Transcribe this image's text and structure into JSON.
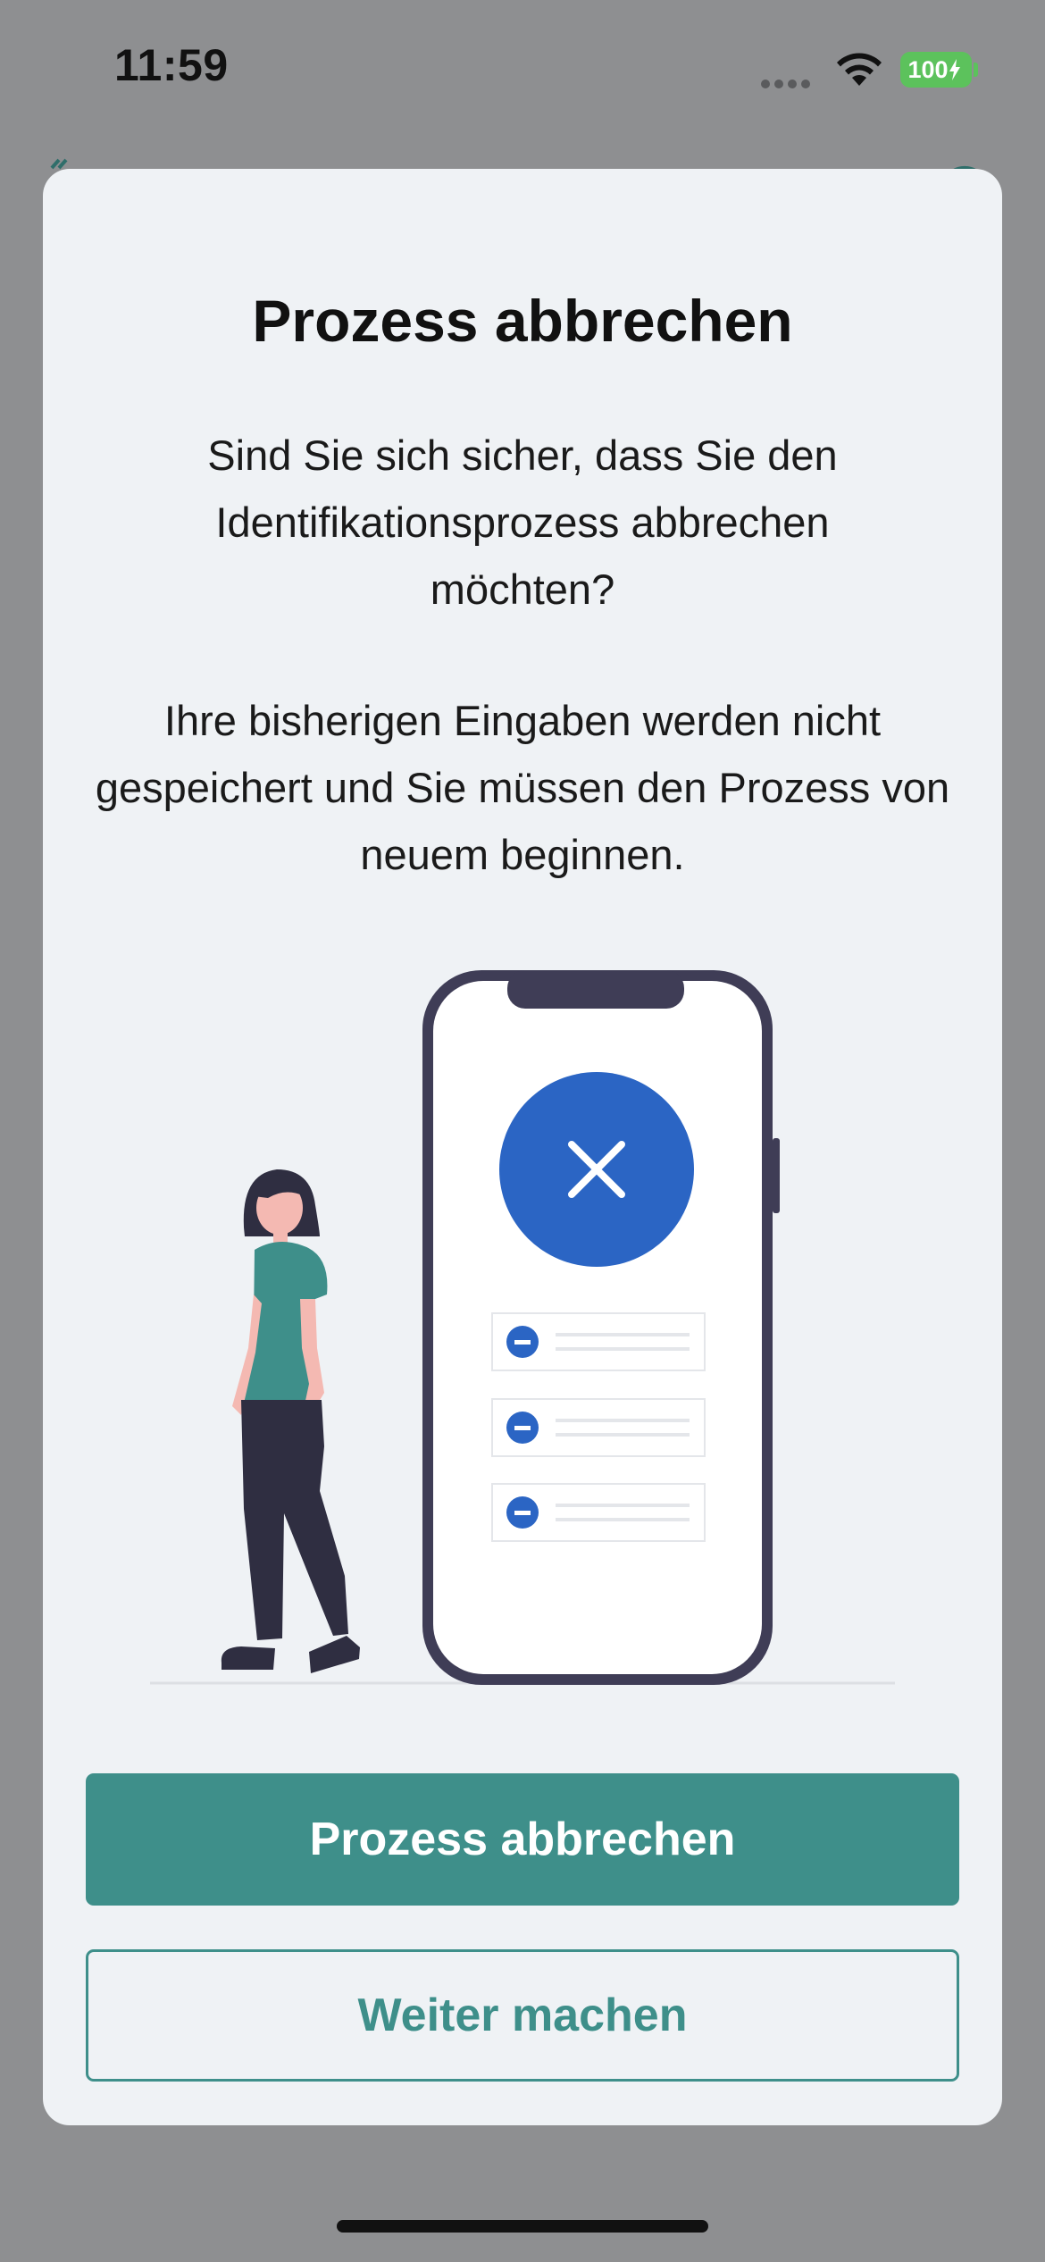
{
  "status_bar": {
    "time": "11:59",
    "battery_label": "100"
  },
  "dialog": {
    "title": "Prozess abbrechen",
    "message_1": "Sind Sie sich sicher, dass Sie den Identifikationsprozess abbrechen möchten?",
    "message_2": "Ihre bisherigen Eingaben werden nicht gespeichert und Sie müssen den Prozess von neuem beginnen.",
    "primary_button": "Prozess abbrechen",
    "secondary_button": "Weiter machen"
  },
  "colors": {
    "accent": "#3e8f8a",
    "illustration_blue": "#2b65c4",
    "phone_frame": "#3f3d56",
    "background_overlay": "#8e8f91",
    "sheet": "#eff2f5"
  },
  "icons": {
    "status_wifi": "wifi-icon",
    "status_battery": "battery-charging-icon",
    "illustration_cancel": "close-icon",
    "list_item_marker": "minus-circle-icon"
  }
}
